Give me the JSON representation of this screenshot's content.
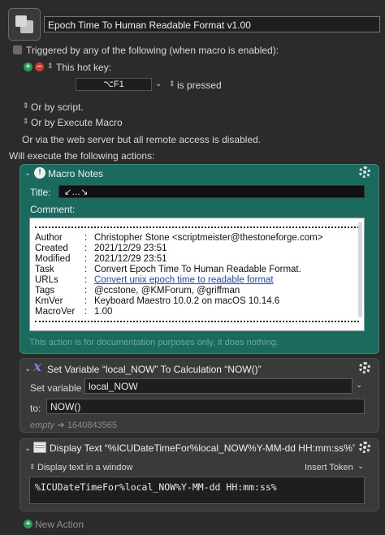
{
  "macro": {
    "name": "Epoch Time To Human Readable Format v1.00"
  },
  "triggers": {
    "triggered_label": "Triggered by any of the following (when macro is enabled):",
    "hotkey_label": "This hot key:",
    "hotkey_value": "⌥F1",
    "hotkey_condition": "is pressed",
    "or_by_script": "Or by script.",
    "or_by_execute_macro": "Or by Execute Macro",
    "web_server_note": "Or via the web server but all remote access is disabled.",
    "will_execute": "Will execute the following actions:"
  },
  "notes_action": {
    "header": "Macro Notes",
    "title_label": "Title:",
    "title_value": "↙…↘",
    "comment_label": "Comment:",
    "comment_rows": [
      {
        "key": "Author",
        "val": "Christopher Stone <scriptmeister@thestoneforge.com>"
      },
      {
        "key": "Created",
        "val": "2021/12/29 23:51"
      },
      {
        "key": "Modified",
        "val": "2021/12/29 23:51"
      },
      {
        "key": "Task",
        "val": "Convert Epoch Time To Human Readable Format."
      },
      {
        "key": "URLs",
        "val": "Convert unix epoch time to readable format"
      },
      {
        "key": "Tags",
        "val": "@ccstone, @KMForum, @griffman"
      },
      {
        "key": "KmVer",
        "val": "Keyboard Maestro 10.0.2 on macOS 10.14.6"
      },
      {
        "key": "MacroVer",
        "val": "1.00"
      }
    ],
    "doc_note": "This action is for documentation purposes only, it does nothing."
  },
  "setvar_action": {
    "header": "Set Variable “local_NOW” To Calculation “NOW()”",
    "set_label": "Set variable",
    "set_value": "local_NOW",
    "to_label": "to:",
    "to_value": "NOW()",
    "empty_label": "empty",
    "arrow": "➔",
    "preview_value": "1640843565"
  },
  "display_action": {
    "header": "Display Text “%ICUDateTimeFor%local_NOW%Y-MM-dd HH:mm:ss%” in…",
    "mode_label": "Display text in a window",
    "insert_token": "Insert Token",
    "text_value": "%ICUDateTimeFor%local_NOW%Y-MM-dd HH:mm:ss%"
  },
  "footer": {
    "new_action": "New Action"
  },
  "colors": {
    "accent_green": "#1fa34a",
    "accent_red": "#d33a2c",
    "notes_teal": "#1b6a60",
    "link_blue": "#2244cc"
  }
}
